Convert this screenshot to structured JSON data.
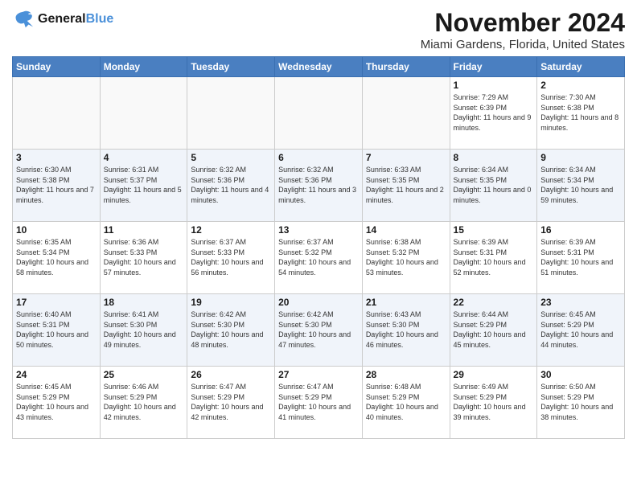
{
  "logo": {
    "line1": "General",
    "line2": "Blue"
  },
  "title": "November 2024",
  "location": "Miami Gardens, Florida, United States",
  "weekdays": [
    "Sunday",
    "Monday",
    "Tuesday",
    "Wednesday",
    "Thursday",
    "Friday",
    "Saturday"
  ],
  "weeks": [
    [
      {
        "day": "",
        "info": ""
      },
      {
        "day": "",
        "info": ""
      },
      {
        "day": "",
        "info": ""
      },
      {
        "day": "",
        "info": ""
      },
      {
        "day": "",
        "info": ""
      },
      {
        "day": "1",
        "info": "Sunrise: 7:29 AM\nSunset: 6:39 PM\nDaylight: 11 hours and 9 minutes."
      },
      {
        "day": "2",
        "info": "Sunrise: 7:30 AM\nSunset: 6:38 PM\nDaylight: 11 hours and 8 minutes."
      }
    ],
    [
      {
        "day": "3",
        "info": "Sunrise: 6:30 AM\nSunset: 5:38 PM\nDaylight: 11 hours and 7 minutes."
      },
      {
        "day": "4",
        "info": "Sunrise: 6:31 AM\nSunset: 5:37 PM\nDaylight: 11 hours and 5 minutes."
      },
      {
        "day": "5",
        "info": "Sunrise: 6:32 AM\nSunset: 5:36 PM\nDaylight: 11 hours and 4 minutes."
      },
      {
        "day": "6",
        "info": "Sunrise: 6:32 AM\nSunset: 5:36 PM\nDaylight: 11 hours and 3 minutes."
      },
      {
        "day": "7",
        "info": "Sunrise: 6:33 AM\nSunset: 5:35 PM\nDaylight: 11 hours and 2 minutes."
      },
      {
        "day": "8",
        "info": "Sunrise: 6:34 AM\nSunset: 5:35 PM\nDaylight: 11 hours and 0 minutes."
      },
      {
        "day": "9",
        "info": "Sunrise: 6:34 AM\nSunset: 5:34 PM\nDaylight: 10 hours and 59 minutes."
      }
    ],
    [
      {
        "day": "10",
        "info": "Sunrise: 6:35 AM\nSunset: 5:34 PM\nDaylight: 10 hours and 58 minutes."
      },
      {
        "day": "11",
        "info": "Sunrise: 6:36 AM\nSunset: 5:33 PM\nDaylight: 10 hours and 57 minutes."
      },
      {
        "day": "12",
        "info": "Sunrise: 6:37 AM\nSunset: 5:33 PM\nDaylight: 10 hours and 56 minutes."
      },
      {
        "day": "13",
        "info": "Sunrise: 6:37 AM\nSunset: 5:32 PM\nDaylight: 10 hours and 54 minutes."
      },
      {
        "day": "14",
        "info": "Sunrise: 6:38 AM\nSunset: 5:32 PM\nDaylight: 10 hours and 53 minutes."
      },
      {
        "day": "15",
        "info": "Sunrise: 6:39 AM\nSunset: 5:31 PM\nDaylight: 10 hours and 52 minutes."
      },
      {
        "day": "16",
        "info": "Sunrise: 6:39 AM\nSunset: 5:31 PM\nDaylight: 10 hours and 51 minutes."
      }
    ],
    [
      {
        "day": "17",
        "info": "Sunrise: 6:40 AM\nSunset: 5:31 PM\nDaylight: 10 hours and 50 minutes."
      },
      {
        "day": "18",
        "info": "Sunrise: 6:41 AM\nSunset: 5:30 PM\nDaylight: 10 hours and 49 minutes."
      },
      {
        "day": "19",
        "info": "Sunrise: 6:42 AM\nSunset: 5:30 PM\nDaylight: 10 hours and 48 minutes."
      },
      {
        "day": "20",
        "info": "Sunrise: 6:42 AM\nSunset: 5:30 PM\nDaylight: 10 hours and 47 minutes."
      },
      {
        "day": "21",
        "info": "Sunrise: 6:43 AM\nSunset: 5:30 PM\nDaylight: 10 hours and 46 minutes."
      },
      {
        "day": "22",
        "info": "Sunrise: 6:44 AM\nSunset: 5:29 PM\nDaylight: 10 hours and 45 minutes."
      },
      {
        "day": "23",
        "info": "Sunrise: 6:45 AM\nSunset: 5:29 PM\nDaylight: 10 hours and 44 minutes."
      }
    ],
    [
      {
        "day": "24",
        "info": "Sunrise: 6:45 AM\nSunset: 5:29 PM\nDaylight: 10 hours and 43 minutes."
      },
      {
        "day": "25",
        "info": "Sunrise: 6:46 AM\nSunset: 5:29 PM\nDaylight: 10 hours and 42 minutes."
      },
      {
        "day": "26",
        "info": "Sunrise: 6:47 AM\nSunset: 5:29 PM\nDaylight: 10 hours and 42 minutes."
      },
      {
        "day": "27",
        "info": "Sunrise: 6:47 AM\nSunset: 5:29 PM\nDaylight: 10 hours and 41 minutes."
      },
      {
        "day": "28",
        "info": "Sunrise: 6:48 AM\nSunset: 5:29 PM\nDaylight: 10 hours and 40 minutes."
      },
      {
        "day": "29",
        "info": "Sunrise: 6:49 AM\nSunset: 5:29 PM\nDaylight: 10 hours and 39 minutes."
      },
      {
        "day": "30",
        "info": "Sunrise: 6:50 AM\nSunset: 5:29 PM\nDaylight: 10 hours and 38 minutes."
      }
    ]
  ]
}
